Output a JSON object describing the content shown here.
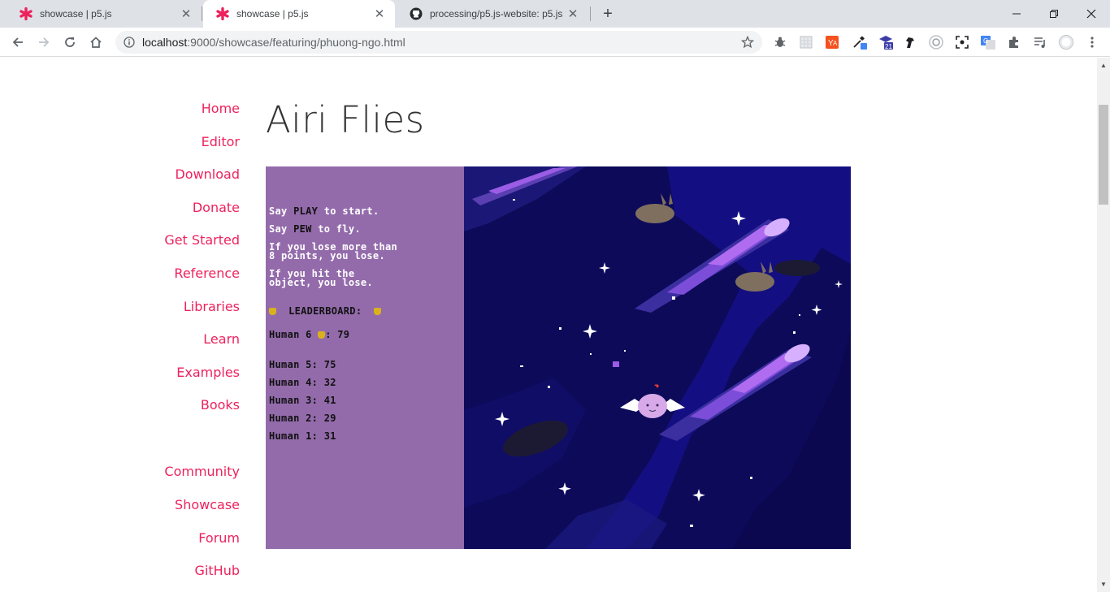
{
  "browser": {
    "tabs": [
      {
        "title": "showcase | p5.js",
        "icon": "p5-asterisk-icon",
        "active": false
      },
      {
        "title": "showcase | p5.js",
        "icon": "p5-asterisk-icon",
        "active": true
      },
      {
        "title": "processing/p5.js-website: p5.js w",
        "icon": "github-icon",
        "active": false
      }
    ],
    "url_host": "localhost",
    "url_rest": ":9000/showcase/featuring/phuong-ngo.html",
    "extension_badge": "21"
  },
  "sidebar": {
    "items": [
      {
        "label": "Home"
      },
      {
        "label": "Editor"
      },
      {
        "label": "Download"
      },
      {
        "label": "Donate"
      },
      {
        "label": "Get Started"
      },
      {
        "label": "Reference"
      },
      {
        "label": "Libraries"
      },
      {
        "label": "Learn"
      },
      {
        "label": "Examples"
      },
      {
        "label": "Books"
      },
      {
        "label": "Community"
      },
      {
        "label": "Showcase"
      },
      {
        "label": "Forum"
      },
      {
        "label": "GitHub"
      }
    ]
  },
  "main": {
    "title": "Airi Flies"
  },
  "game": {
    "instructions": [
      {
        "pre": "Say ",
        "key": "PLAY",
        "post": " to start."
      },
      {
        "pre": "Say ",
        "key": "PEW",
        "post": " to fly."
      }
    ],
    "rule1": "If you lose more than\n8 points, you lose.",
    "rule2": "If you hit the\nobject, you lose.",
    "leaderboard_title": "LEADERBOARD:",
    "current_player": "Human 6",
    "current_score": ": 79",
    "scores": [
      "Human 5: 75",
      "Human 4: 32",
      "Human 3: 41",
      "Human 2: 29",
      "Human 1: 31"
    ]
  },
  "colors": {
    "accent": "#ed225d",
    "panel_purple": "#936bab",
    "space_navy": "#0d0a5a",
    "trophy_gold": "#d9b11c"
  }
}
